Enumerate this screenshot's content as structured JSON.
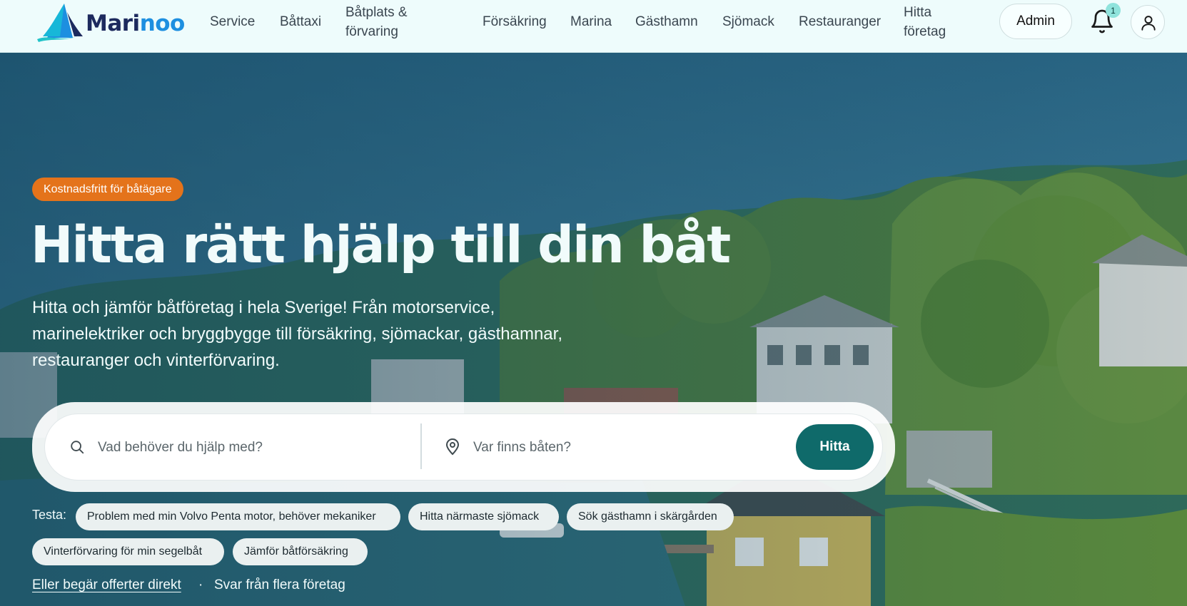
{
  "brand": {
    "name_part1": "Mari",
    "name_part2": "noo"
  },
  "nav": {
    "items": [
      {
        "line1": "Service",
        "line2": ""
      },
      {
        "line1": "Båttaxi",
        "line2": ""
      },
      {
        "line1": "Båtplats &",
        "line2": "förvaring"
      },
      {
        "line1": "Försäkring",
        "line2": ""
      },
      {
        "line1": "Marina",
        "line2": ""
      },
      {
        "line1": "Gästhamn",
        "line2": ""
      },
      {
        "line1": "Sjömack",
        "line2": ""
      },
      {
        "line1": "Restauranger",
        "line2": ""
      },
      {
        "line1": "Hitta",
        "line2": "företag"
      }
    ],
    "admin_label": "Admin",
    "notification_count": "1"
  },
  "hero": {
    "badge": "Kostnadsfritt för båtägare",
    "title": "Hitta rätt hjälp till din båt",
    "subtitle": "Hitta och jämför båtföretag i hela Sverige! Från motorservice, marinelektriker och bryggbygge till försäkring, sjömackar, gästhamnar, restauranger och vinterförvaring."
  },
  "search": {
    "query_placeholder": "Vad behöver du hjälp med?",
    "location_placeholder": "Var finns båten?",
    "button_label": "Hitta"
  },
  "suggestions": {
    "label": "Testa:",
    "chips": [
      "Problem med min Volvo Penta motor, behöver mekaniker",
      "Hitta närmaste sjömack",
      "Sök gästhamn i skärgården",
      "Vinterförvaring för min segelbåt",
      "Jämför båtförsäkring"
    ]
  },
  "offers": {
    "link_label": "Eller begär offerter direkt",
    "separator": "·",
    "note": "Svar från flera företag"
  },
  "colors": {
    "navbar_bg": "#eefcfc",
    "brand_navy": "#1d2a5e",
    "brand_blue": "#1d8fe0",
    "accent_orange": "#e4731b",
    "primary_teal": "#0f6a6a",
    "badge_mint": "#8fe3dc"
  }
}
